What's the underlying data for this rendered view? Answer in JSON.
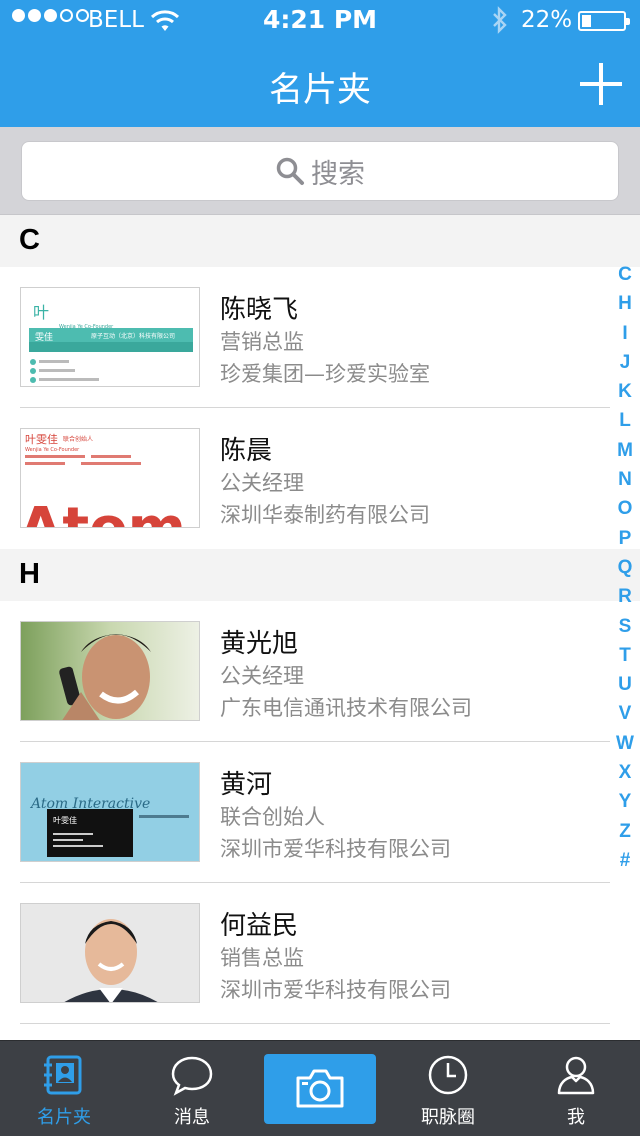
{
  "status": {
    "carrier": "BELL",
    "time": "4:21 PM",
    "battery": "22%",
    "battery_level": 0.22,
    "signal_bars": 3,
    "signal_total": 5
  },
  "nav": {
    "title": "名片夹"
  },
  "search": {
    "placeholder": "搜索"
  },
  "sections": [
    {
      "letter": "C",
      "contacts": [
        {
          "name": "陈晓飞",
          "title": "营销总监",
          "company": "珍爱集团—珍爱实验室"
        },
        {
          "name": "陈晨",
          "title": "公关经理",
          "company": "深圳华泰制药有限公司"
        }
      ]
    },
    {
      "letter": "H",
      "contacts": [
        {
          "name": "黄光旭",
          "title": "公关经理",
          "company": "广东电信通讯技术有限公司"
        },
        {
          "name": "黄河",
          "title": "联合创始人",
          "company": "深圳市爱华科技有限公司"
        },
        {
          "name": "何益民",
          "title": "销售总监",
          "company": "深圳市爱华科技有限公司"
        }
      ]
    }
  ],
  "index_letters": [
    "C",
    "H",
    "I",
    "J",
    "K",
    "L",
    "M",
    "N",
    "O",
    "P",
    "Q",
    "R",
    "S",
    "T",
    "U",
    "V",
    "W",
    "X",
    "Y",
    "Z",
    "#"
  ],
  "cards": {
    "card1_char": "叶",
    "card1_name": "雯佳",
    "card1_role": "Wenjia Ye Co-Founder",
    "card1_company": "原子互动（北京）科技有限公司",
    "card2_name": "叶雯佳",
    "card2_role": "联合创始人",
    "card2_en": "Wenjia Ye Co-Founder",
    "card2_logo": "Atom",
    "card4_script": "Atom Interactive",
    "card4_name": "叶雯佳"
  },
  "tabs": [
    {
      "label": "名片夹",
      "icon": "contacts-book-icon"
    },
    {
      "label": "消息",
      "icon": "chat-bubble-icon"
    },
    {
      "label": "",
      "icon": "camera-icon"
    },
    {
      "label": "职脉圈",
      "icon": "clock-icon"
    },
    {
      "label": "我",
      "icon": "person-icon"
    }
  ],
  "colors": {
    "accent": "#2f9ee9",
    "tabbar": "#3d4045",
    "section_bg": "#f3f3f3",
    "search_bg": "#d4d4d8"
  }
}
